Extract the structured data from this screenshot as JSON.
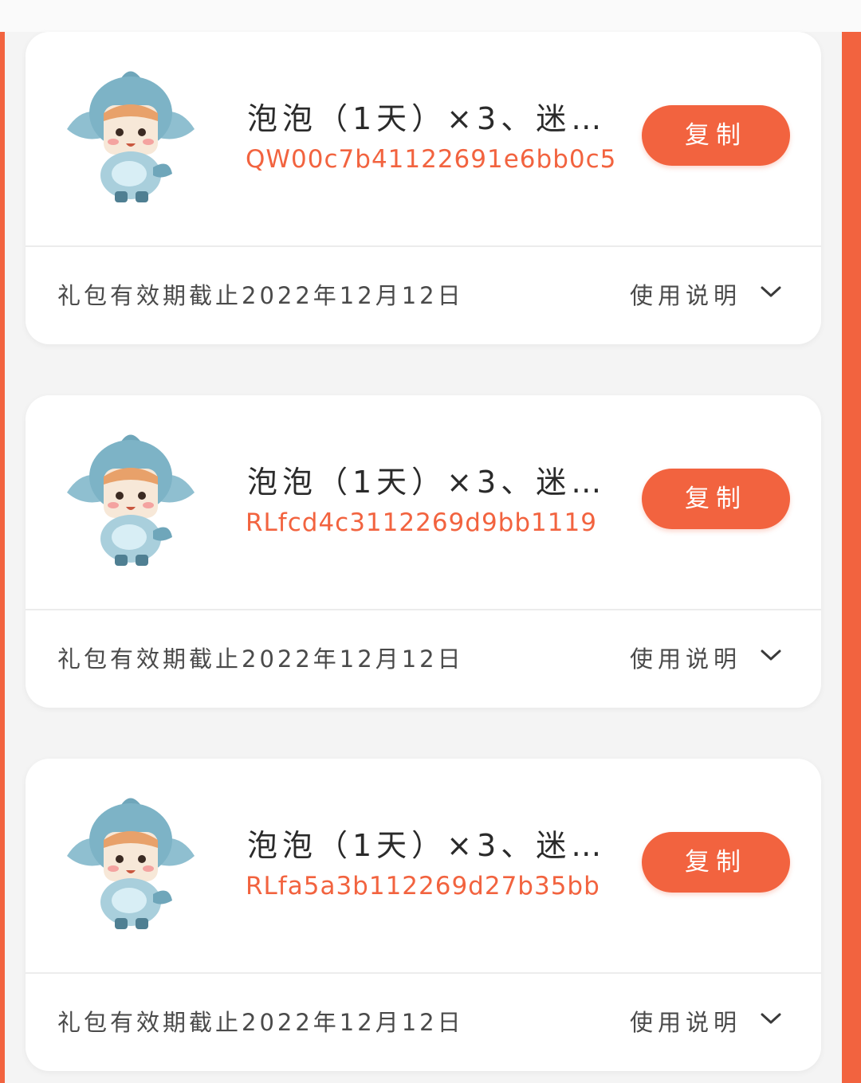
{
  "colors": {
    "accent": "#f2633f",
    "card_bg": "#ffffff",
    "page_bg": "#f4f4f4"
  },
  "gift_packs": [
    {
      "mascot_icon": "shark-hood-mascot-icon",
      "title": "泡泡（1天）×3、迷…",
      "code": "QW00c7b41122691e6bb0c5",
      "copy_label": "复制",
      "validity": "礼包有效期截止2022年12月12日",
      "usage_label": "使用说明",
      "expand_icon": "chevron-down-icon"
    },
    {
      "mascot_icon": "shark-hood-mascot-icon",
      "title": "泡泡（1天）×3、迷…",
      "code": "RLfcd4c3112269d9bb1119",
      "copy_label": "复制",
      "validity": "礼包有效期截止2022年12月12日",
      "usage_label": "使用说明",
      "expand_icon": "chevron-down-icon"
    },
    {
      "mascot_icon": "shark-hood-mascot-icon",
      "title": "泡泡（1天）×3、迷…",
      "code": "RLfa5a3b112269d27b35bb",
      "copy_label": "复制",
      "validity": "礼包有效期截止2022年12月12日",
      "usage_label": "使用说明",
      "expand_icon": "chevron-down-icon"
    }
  ]
}
